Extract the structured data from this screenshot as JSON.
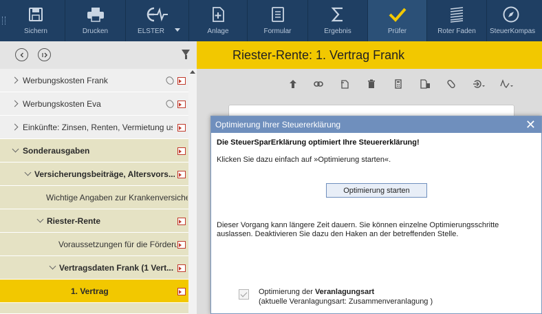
{
  "toolbar": {
    "items": [
      {
        "label": "Sichern",
        "icon": "save-icon"
      },
      {
        "label": "Drucken",
        "icon": "printer-icon"
      },
      {
        "label": "ELSTER",
        "icon": "elster-icon"
      },
      {
        "label": "Anlage",
        "icon": "add-document-icon"
      },
      {
        "label": "Formular",
        "icon": "form-icon"
      },
      {
        "label": "Ergebnis",
        "icon": "sum-icon"
      },
      {
        "label": "Prüfer",
        "icon": "checkmark-icon"
      },
      {
        "label": "Roter Faden",
        "icon": "lines-icon"
      },
      {
        "label": "SteuerKompass",
        "icon": "compass-icon"
      }
    ],
    "active": "Prüfer",
    "colors": {
      "background": "#1f3f63",
      "active": "#2b5077",
      "accent": "#f2c800"
    }
  },
  "nav": {
    "items": [
      {
        "label": "Werbungskosten Frank"
      },
      {
        "label": "Werbungskosten Eva"
      },
      {
        "label": "Einkünfte: Zinsen, Renten, Vermietung usw."
      },
      {
        "label": "Sonderausgaben"
      },
      {
        "label": "Versicherungsbeiträge, Altersvors..."
      },
      {
        "label": "Wichtige Angaben zur Krankenversicher..."
      },
      {
        "label": "Riester-Rente"
      },
      {
        "label": "Voraussetzungen für die Förderung"
      },
      {
        "label": "Vertragsdaten Frank (1 Vert..."
      },
      {
        "label": "1. Vertrag"
      }
    ]
  },
  "main": {
    "title": "Riester-Rente: 1. Vertrag Frank"
  },
  "dialog": {
    "title": "Optimierung Ihrer Steuererklärung",
    "close": "✕",
    "heading": "Die SteuerSparErklärung optimiert Ihre Steuererklärung!",
    "instruction": "Klicken Sie dazu einfach auf »Optimierung starten«.",
    "start_button": "Optimierung starten",
    "info": "Dieser Vorgang kann längere Zeit dauern. Sie können einzelne Optimierungsschritte auslassen. Deaktivieren Sie dazu den Haken an der betreffenden Stelle.",
    "option": {
      "prefix": "Optimierung der ",
      "bold": "Veranlagungsart",
      "detail": "(aktuelle Veranlagungsart: Zusammenveranlagung )",
      "checked": true
    }
  }
}
